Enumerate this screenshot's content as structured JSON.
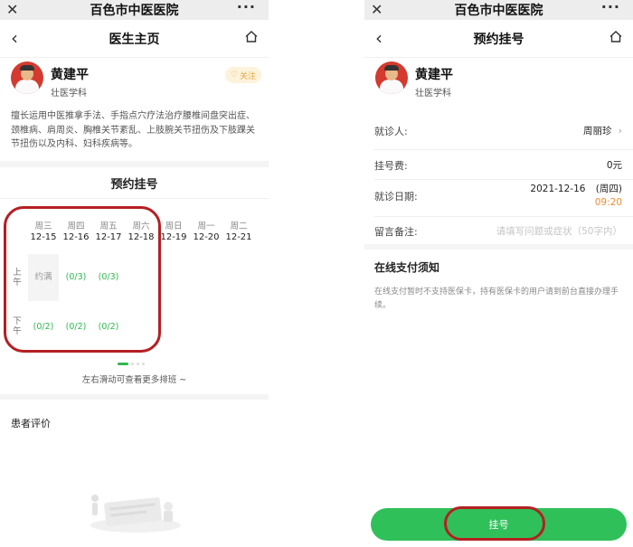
{
  "wechat": {
    "title": "百色市中医医院",
    "close_icon": "close-icon",
    "more_icon": "more-dots-icon"
  },
  "left": {
    "nav_title": "医生主页",
    "doctor": {
      "name": "黄建平",
      "department": "壮医学科"
    },
    "follow_label": "关注",
    "description": "擅长运用中医推拿手法、手指点穴疗法治疗腰椎间盘突出症、颈椎病、肩周炎、胸椎关节紊乱、上肢腕关节扭伤及下肢踝关节扭伤以及内科、妇科疾病等。",
    "schedule_title": "预约挂号",
    "days": [
      {
        "weekday": "周三",
        "date": "12-15"
      },
      {
        "weekday": "周四",
        "date": "12-16"
      },
      {
        "weekday": "周五",
        "date": "12-17"
      },
      {
        "weekday": "周六",
        "date": "12-18"
      },
      {
        "weekday": "周日",
        "date": "12-19"
      },
      {
        "weekday": "周一",
        "date": "12-20"
      },
      {
        "weekday": "周二",
        "date": "12-21"
      }
    ],
    "periods": {
      "morning": "上午",
      "afternoon": "下午"
    },
    "morning_slots": [
      "约满",
      "(0/3)",
      "(0/3)"
    ],
    "afternoon_slots": [
      "(0/2)",
      "(0/2)",
      "(0/2)"
    ],
    "carousel": {
      "pages": 4,
      "active_page": 1
    },
    "scroll_hint": "左右滑动可查看更多排班 ~",
    "reviews_title": "患者评价"
  },
  "right": {
    "nav_title": "预约挂号",
    "doctor": {
      "name": "黄建平",
      "department": "壮医学科"
    },
    "patient_label": "就诊人:",
    "patient_value": "周丽珍",
    "fee_label": "挂号费:",
    "fee_value": "0元",
    "date_label": "就诊日期:",
    "date_value": "2021-12-16",
    "weekday_value": "(周四)",
    "time_value": "09:20",
    "note_label": "留言备注:",
    "note_placeholder": "请填写问题或症状（50字内）",
    "notice_title": "在线支付须知",
    "notice_body": "在线支付暂时不支持医保卡，持有医保卡的用户请到前台直接办理手续。",
    "register_button": "挂号"
  },
  "colors": {
    "accent_green": "#30c05a",
    "annotation_red": "#b51f23",
    "time_orange": "#f08d34",
    "follow_gold": "#e8a33a"
  }
}
